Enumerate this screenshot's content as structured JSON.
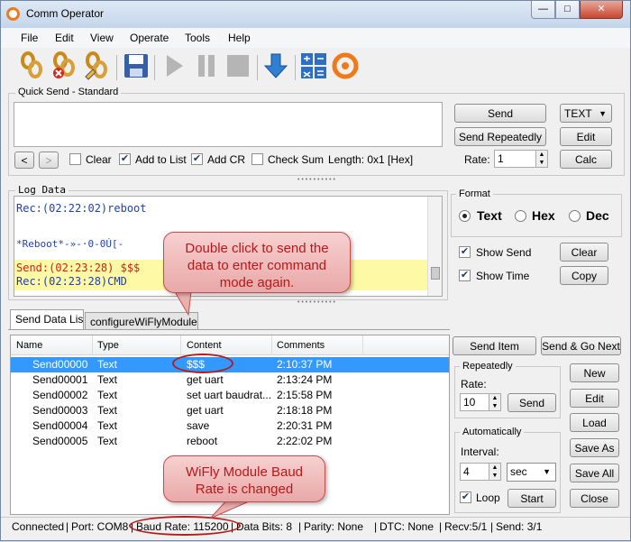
{
  "window": {
    "title": "Comm Operator",
    "minimize": "—",
    "maximize": "□",
    "close": "✕"
  },
  "menu": [
    "File",
    "Edit",
    "View",
    "Operate",
    "Tools",
    "Help"
  ],
  "toolbar_icons": [
    "open-port-icon",
    "close-port-icon",
    "edit-port-icon",
    "save-icon",
    "play-icon",
    "pause-icon",
    "stop-icon",
    "download-icon",
    "calculator-icon",
    "comm-operator-logo-icon"
  ],
  "quick_send": {
    "title": "Quick Send - Standard",
    "input_value": "",
    "send": "Send",
    "send_repeatedly": "Send Repeatedly",
    "format": "TEXT",
    "edit": "Edit",
    "calc": "Calc",
    "rate_label": "Rate:",
    "rate_value": "1",
    "prev": "<",
    "next": ">",
    "clear": {
      "label": "Clear",
      "checked": false
    },
    "add_to_list": {
      "label": "Add to List",
      "checked": true
    },
    "add_cr": {
      "label": "Add CR",
      "checked": true
    },
    "check_sum": {
      "label": "Check Sum",
      "checked": false
    },
    "length": "Length: 0x1 [Hex]"
  },
  "log": {
    "title": "Log Data",
    "lines": [
      {
        "text": "Rec:(02:22:02)reboot",
        "color": "#1f3fb5",
        "highlight": false
      },
      {
        "text": "*Reboot*-»-·0-0Ú[-",
        "color": "#1f3fb5",
        "highlight": false
      },
      {
        "text": "Send:(02:23:28) $$$",
        "color": "#d01d1d",
        "highlight": true
      },
      {
        "text": "Rec:(02:23:28)CMD",
        "color": "#1f3fb5",
        "highlight": true
      }
    ]
  },
  "format": {
    "title": "Format",
    "options": [
      "Text",
      "Hex",
      "Dec"
    ],
    "selected": "Text",
    "show_send": {
      "label": "Show Send",
      "checked": true
    },
    "show_time": {
      "label": "Show Time",
      "checked": true
    },
    "clear": "Clear",
    "copy": "Copy"
  },
  "tabs": [
    "Send Data List",
    "configureWiFlyModule.s"
  ],
  "table": {
    "columns": [
      "Name",
      "Type",
      "Content",
      "Comments"
    ],
    "rows": [
      [
        "Send00000",
        "Text",
        "$$$",
        "2:10:37 PM"
      ],
      [
        "Send00001",
        "Text",
        "get uart",
        "2:13:24 PM"
      ],
      [
        "Send00002",
        "Text",
        "set uart baudrat...",
        "2:15:58 PM"
      ],
      [
        "Send00003",
        "Text",
        "get uart",
        "2:18:18 PM"
      ],
      [
        "Send00004",
        "Text",
        "save",
        "2:20:31 PM"
      ],
      [
        "Send00005",
        "Text",
        "reboot",
        "2:22:02 PM"
      ]
    ],
    "selected_row": 0
  },
  "list_actions": {
    "send_item": "Send Item",
    "send_go_next": "Send & Go Next",
    "repeatedly_title": "Repeatedly",
    "rate_label": "Rate:",
    "rate_value": "10",
    "send": "Send",
    "auto_title": "Automatically",
    "interval_label": "Interval:",
    "interval_value": "4",
    "interval_unit": "sec",
    "loop": {
      "label": "Loop",
      "checked": true
    },
    "start": "Start",
    "new": "New",
    "edit": "Edit",
    "load": "Load",
    "save_as": "Save As",
    "save_all": "Save All",
    "close": "Close"
  },
  "callouts": {
    "double_click": "Double click to send the data to enter command mode again.",
    "baud": "WiFly Module Baud Rate is changed"
  },
  "status": {
    "connected": "Connected",
    "port": "Port: COM8",
    "baud": "Baud Rate: 115200",
    "data_bits": "Data Bits: 8",
    "parity": "Parity: None",
    "dtc": "DTC: None",
    "recv": "Recv:5/1",
    "send": "Send: 3/1"
  },
  "colors": {
    "accent": "#3399ff",
    "callout_text": "#b91818",
    "log_rec": "#1f3fb5",
    "log_send": "#d01d1d",
    "highlight": "#fdf9a4"
  }
}
